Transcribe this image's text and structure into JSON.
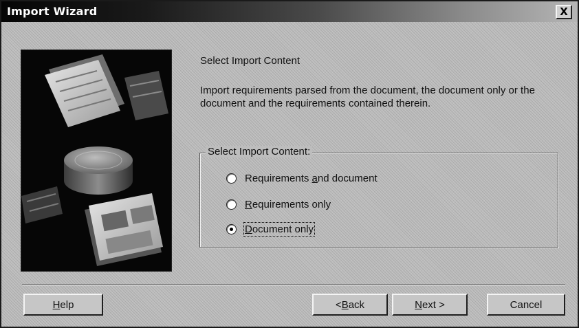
{
  "window": {
    "title": "Import Wizard",
    "close_glyph": "X"
  },
  "main": {
    "heading": "Select Import Content",
    "description": "Import requirements parsed from the document, the document only or the document and the requirements contained therein.",
    "group_label": "Select Import Content:",
    "options": [
      {
        "pre": "Requirements ",
        "key": "a",
        "post": "nd document",
        "checked": false
      },
      {
        "pre": "",
        "key": "R",
        "post": "equirements only",
        "checked": false
      },
      {
        "pre": "",
        "key": "D",
        "post": "ocument only",
        "checked": true
      }
    ]
  },
  "buttons": {
    "help": {
      "pre": "",
      "key": "H",
      "post": "elp"
    },
    "back": {
      "pre": "< ",
      "key": "B",
      "post": "ack"
    },
    "next": {
      "pre": "",
      "key": "N",
      "post": "ext >"
    },
    "cancel": {
      "label": "Cancel"
    }
  },
  "icons": {
    "side_image": "wizard-illustration-documents-and-database"
  },
  "colors": {
    "dialog_face": "#bdbdbd",
    "title_gradient_start": "#050505",
    "title_gradient_end": "#b5b5b5",
    "side_image_background": "#060606"
  }
}
